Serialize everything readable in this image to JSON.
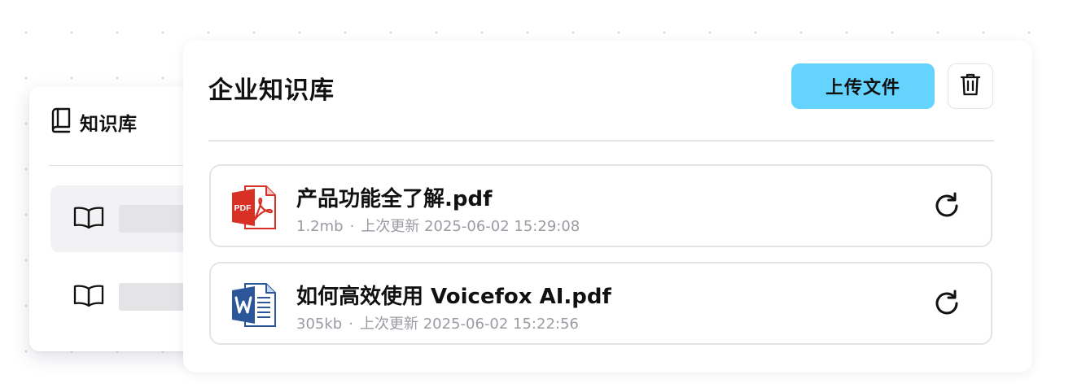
{
  "sidebar": {
    "title": "知识库",
    "title_icon": "book-icon",
    "items": [
      {
        "icon": "open-book-icon",
        "active": true
      },
      {
        "icon": "open-book-icon",
        "active": false
      }
    ]
  },
  "panel": {
    "title": "企业知识库",
    "upload_label": "上传文件",
    "delete_icon": "trash-icon",
    "meta_separator": "·",
    "files": [
      {
        "name": "产品功能全了解.pdf",
        "size": "1.2mb",
        "updated_label": "上次更新",
        "updated_at": "2025-06-02 15:29:08",
        "icon": "pdf-file-icon",
        "action_icon": "refresh-icon"
      },
      {
        "name": "如何高效使用 Voicefox AI.pdf",
        "size": "305kb",
        "updated_label": "上次更新",
        "updated_at": "2025-06-02 15:22:56",
        "icon": "word-file-icon",
        "action_icon": "refresh-icon"
      }
    ]
  },
  "colors": {
    "accent": "#64d4ff",
    "pdf_red": "#d93025",
    "word_blue": "#2b579a",
    "muted_text": "#9b9ba3",
    "border": "#e4e4e7"
  }
}
